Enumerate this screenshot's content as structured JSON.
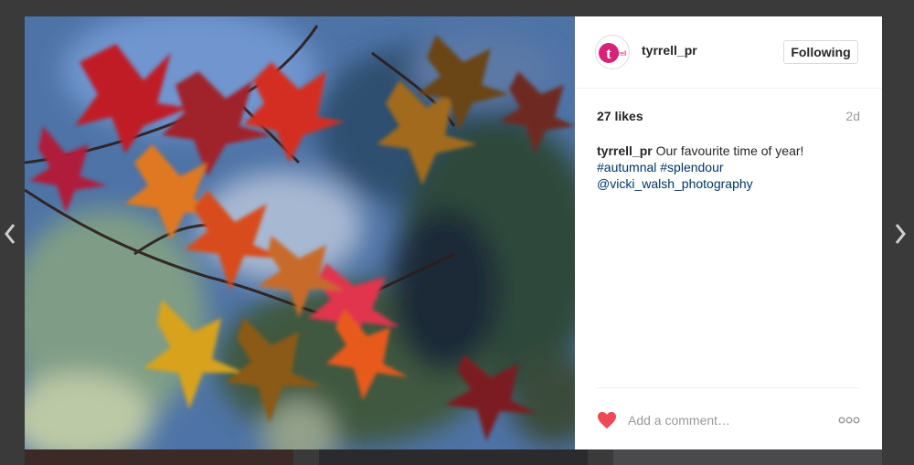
{
  "post": {
    "username": "tyrrell_pr",
    "follow_label": "Following",
    "likes": "27 likes",
    "time_ago": "2d",
    "caption_user": "tyrrell_pr",
    "caption_text": "Our favourite time of year!",
    "hashtags": "#autumnal #splendour",
    "mention": "@vicki_walsh_photography",
    "comment_placeholder": "Add a comment…",
    "avatar_logo": "tyrell"
  },
  "colors": {
    "heart": "#ed4956",
    "avatar_accent": "#d6237a",
    "link": "#003569"
  },
  "icons": {
    "prev": "chevron-left-icon",
    "next": "chevron-right-icon",
    "like": "heart-icon",
    "more": "more-options-icon"
  }
}
